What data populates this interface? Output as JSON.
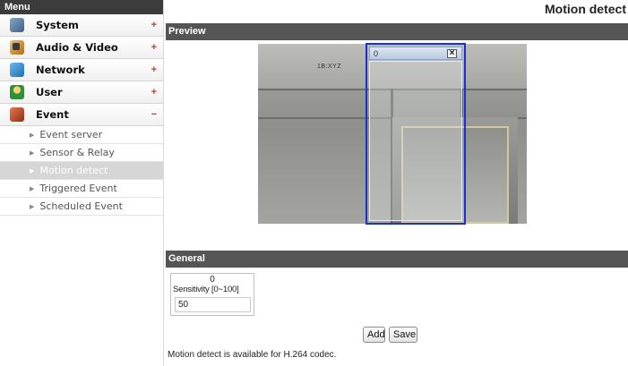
{
  "sidebar": {
    "header": "Menu",
    "items": [
      {
        "label": "System",
        "icon": "system-icon",
        "toggle": "+"
      },
      {
        "label": "Audio & Video",
        "icon": "audio-video-icon",
        "toggle": "+"
      },
      {
        "label": "Network",
        "icon": "network-icon",
        "toggle": "+"
      },
      {
        "label": "User",
        "icon": "user-icon",
        "toggle": "+"
      },
      {
        "label": "Event",
        "icon": "event-icon",
        "toggle": "−"
      }
    ],
    "event_subitems": [
      {
        "label": "Event server"
      },
      {
        "label": "Sensor & Relay"
      },
      {
        "label": "Motion detect",
        "active": true
      },
      {
        "label": "Triggered Event"
      },
      {
        "label": "Scheduled Event"
      }
    ]
  },
  "main": {
    "title": "Motion detect",
    "preview": {
      "section_label": "Preview",
      "camera_overlay_text": "1B:XYZ",
      "region": {
        "id": "0",
        "close": "×",
        "border_color": "#1a2fd4"
      }
    },
    "general": {
      "section_label": "General",
      "region_id": "0",
      "sensitivity_label": "Sensitivity [0~100]",
      "sensitivity_value": "50"
    },
    "buttons": {
      "add": "Add",
      "save": "Save"
    },
    "note": "Motion detect is available for H.264 codec."
  },
  "colors": {
    "header_bg": "#3c3c3c",
    "section_bar": "#555555",
    "active_subitem": "#d6d6d6",
    "toggle": "#c0392b"
  }
}
